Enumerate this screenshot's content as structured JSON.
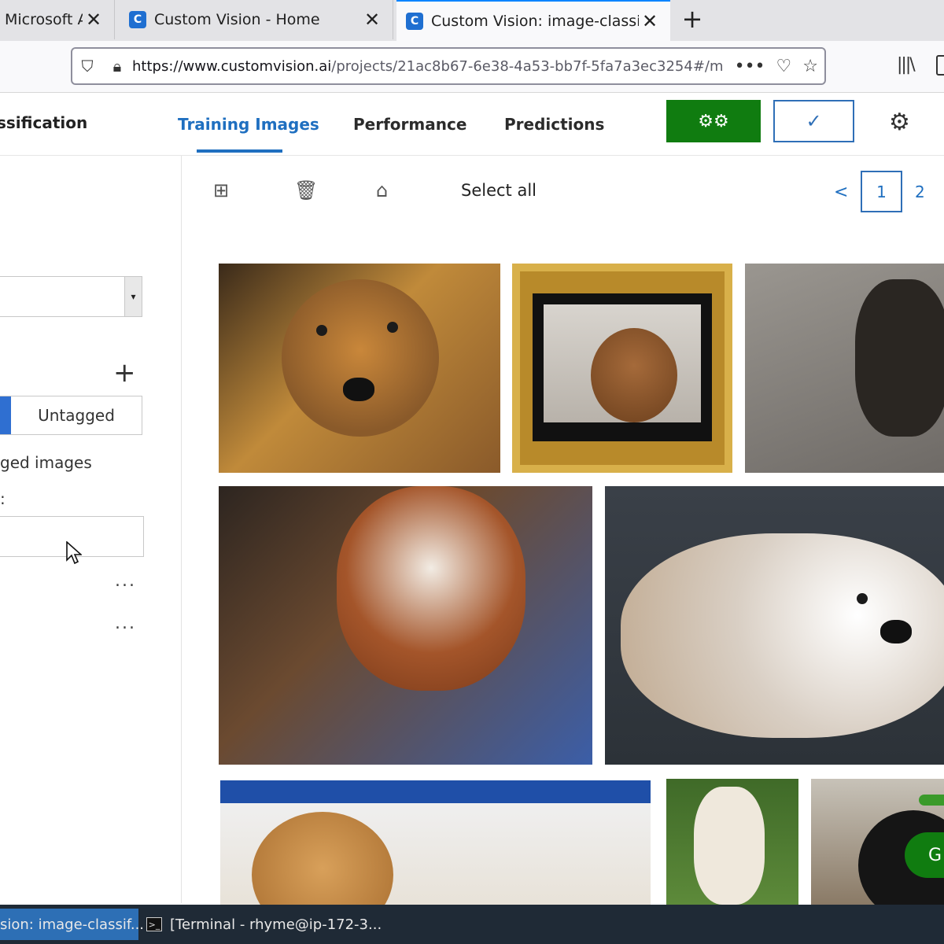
{
  "browser": {
    "tabs": [
      {
        "title": "Microsoft Az",
        "favicon": "",
        "active": false
      },
      {
        "title": "Custom Vision - Home",
        "favicon": "custom-vision-icon",
        "active": false
      },
      {
        "title": "Custom Vision: image-classifi",
        "favicon": "custom-vision-icon",
        "active": true
      }
    ],
    "url_host": "https://www.customvision.ai",
    "url_path": "/projects/21ac8b67-6e38-4a53-bb7f-5fa7a3ec3254#/m"
  },
  "header": {
    "project_name": "ssification",
    "tabs": [
      {
        "label": "Training Images",
        "active": true
      },
      {
        "label": "Performance",
        "active": false
      },
      {
        "label": "Predictions",
        "active": false
      }
    ],
    "train_button_icon": "gears-icon",
    "quick_test_icon": "check-icon",
    "settings_icon": "gear-icon"
  },
  "left_panel": {
    "untagged_label": "Untagged",
    "show_label": "ged images",
    "filter_label": ":",
    "more_label": "..."
  },
  "toolbar": {
    "select_all": "Select all",
    "pager_prev": "<",
    "pager_current": "1",
    "pager_next": "2"
  },
  "taskbar": {
    "items": [
      {
        "label": "sion: image-classif...",
        "active": true
      },
      {
        "label": "[Terminal - rhyme@ip-172-3...",
        "active": false
      }
    ]
  },
  "colors": {
    "accent": "#1f6fc0",
    "train_green": "#107c10",
    "taskbar": "#1f2a36"
  }
}
